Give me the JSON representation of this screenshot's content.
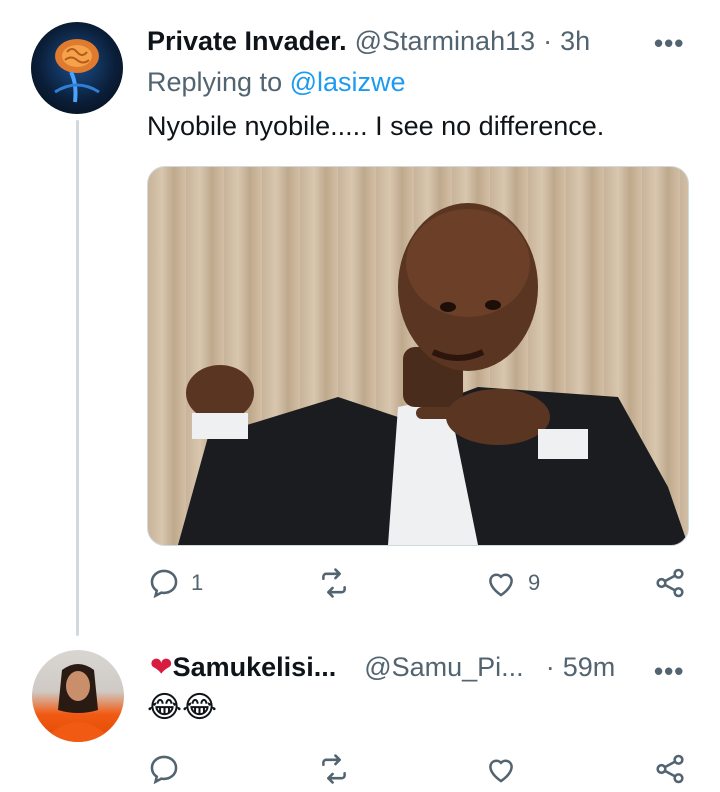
{
  "tweet1": {
    "display_name": "Private Invader.",
    "handle": "@Starminah13",
    "separator": "·",
    "time": "3h",
    "more_label": "•••",
    "replying_prefix": "Replying to",
    "replying_handle": "@lasizwe",
    "text": "Nyobile nyobile..... I see no difference.",
    "reply_count": "1",
    "like_count": "9",
    "avatar_icon": "brain-xray-avatar"
  },
  "tweet2": {
    "heart": "❤",
    "display_name": "Samukelisi...",
    "handle": "@Samu_Pi...",
    "separator": "·",
    "time": "59m",
    "more_label": "•••",
    "text": "😂😂",
    "avatar_icon": "person-avatar"
  },
  "colors": {
    "accent": "#1d9bf0",
    "muted": "#536471",
    "heart": "#d81c3f"
  }
}
